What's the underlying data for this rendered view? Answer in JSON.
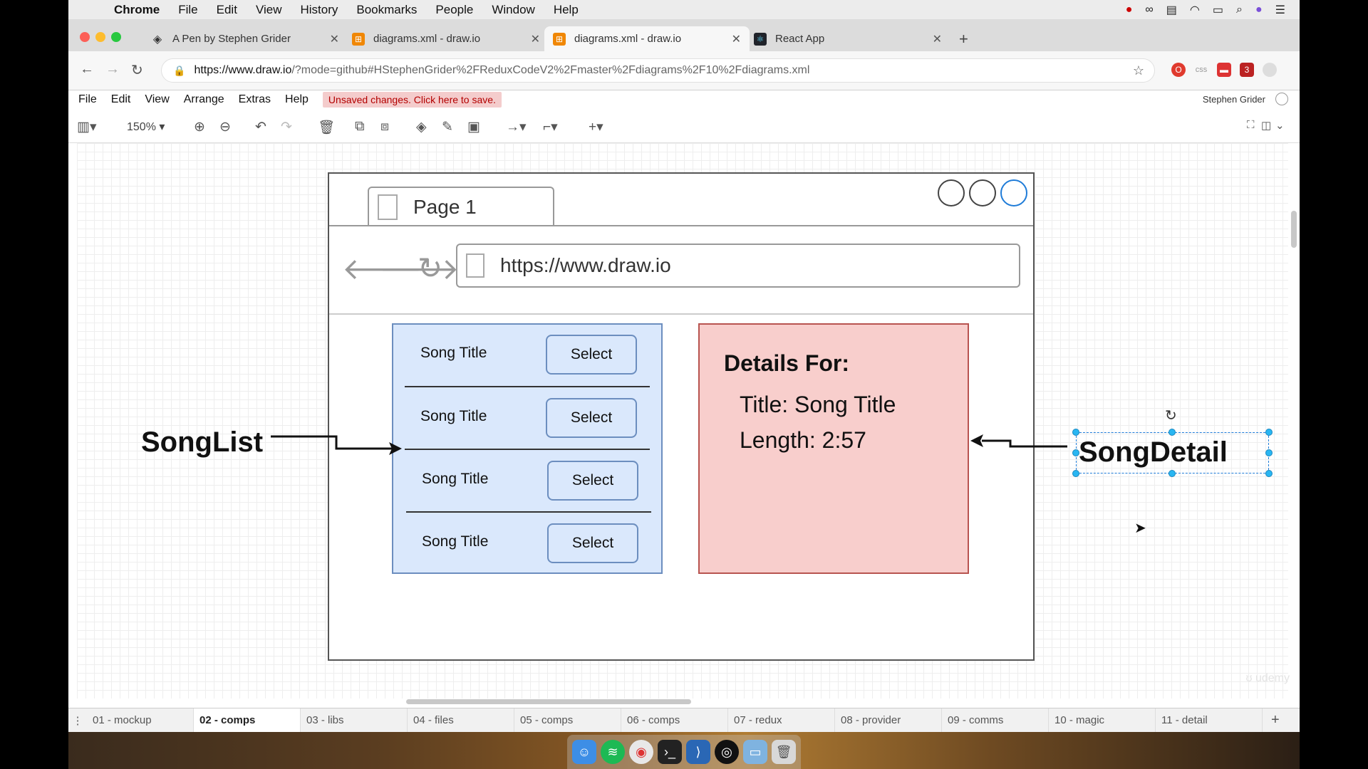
{
  "menubar": {
    "app": "Chrome",
    "items": [
      "File",
      "Edit",
      "View",
      "History",
      "Bookmarks",
      "People",
      "Window",
      "Help"
    ]
  },
  "tabs": [
    {
      "title": "A Pen by Stephen Grider",
      "icon": "codepen-icon"
    },
    {
      "title": "diagrams.xml - draw.io",
      "icon": "drawio-icon"
    },
    {
      "title": "diagrams.xml - draw.io",
      "icon": "drawio-icon",
      "active": true
    },
    {
      "title": "React App",
      "icon": "react-icon"
    }
  ],
  "address": {
    "url_host": "https://www.draw.io",
    "url_rest": "/?mode=github#HStephenGrider%2FReduxCodeV2%2Fmaster%2Fdiagrams%2F10%2Fdiagrams.xml"
  },
  "extensions": {
    "css_label": "css",
    "badge_count": "3"
  },
  "drawio": {
    "menu": [
      "File",
      "Edit",
      "View",
      "Arrange",
      "Extras",
      "Help"
    ],
    "unsaved": "Unsaved changes. Click here to save.",
    "user": "Stephen Grider",
    "zoom": "150%"
  },
  "diagram": {
    "page_tab": "Page 1",
    "url": "https://www.draw.io",
    "songs": [
      {
        "title": "Song Title",
        "button": "Select"
      },
      {
        "title": "Song Title",
        "button": "Select"
      },
      {
        "title": "Song Title",
        "button": "Select"
      },
      {
        "title": "Song Title",
        "button": "Select"
      }
    ],
    "details_heading": "Details For:",
    "details_title": "Title: Song Title",
    "details_length": "Length: 2:57",
    "label_left": "SongList",
    "label_right": "SongDetail"
  },
  "pages": [
    "01 - mockup",
    "02 - comps",
    "03 - libs",
    "04 - files",
    "05 - comps",
    "06 - comps",
    "07 - redux",
    "08 - provider",
    "09 - comms",
    "10 - magic",
    "11 - detail"
  ],
  "active_page": "02 - comps",
  "colors": {
    "songlist_fill": "#dae8fc",
    "songlist_stroke": "#6c8ebf",
    "details_fill": "#f8cecc",
    "details_stroke": "#b85450",
    "unsaved_text": "#b30000",
    "selection": "#29b6f2"
  }
}
